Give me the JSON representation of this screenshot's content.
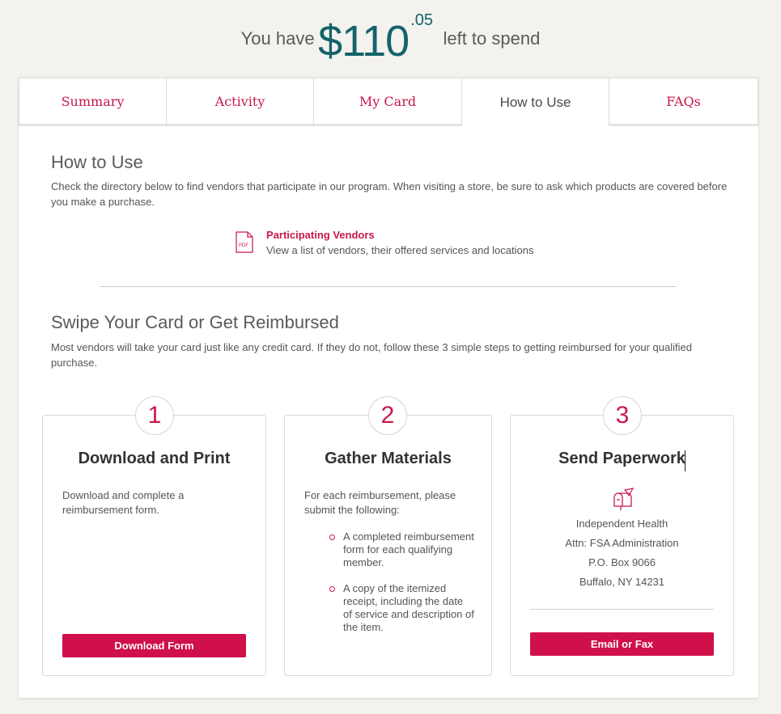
{
  "balance": {
    "prefix": "You have",
    "dollars": "$110",
    "cents": ".05",
    "suffix": "left to spend"
  },
  "tabs": [
    {
      "label": "Summary",
      "active": false
    },
    {
      "label": "Activity",
      "active": false
    },
    {
      "label": "My Card",
      "active": false
    },
    {
      "label": "How to Use",
      "active": true
    },
    {
      "label": "FAQs",
      "active": false
    }
  ],
  "how_to_use": {
    "title": "How to Use",
    "description": "Check the directory below to find vendors that participate in our program. When visiting a store, be sure to ask which products are covered before you make a purchase.",
    "pdf_icon_label": "PDF",
    "vendor_link": "Participating Vendors",
    "vendor_desc": "View a list of vendors, their offered services and locations"
  },
  "swipe": {
    "title": "Swipe Your Card or Get Reimbursed",
    "description": "Most vendors will take your card just like any credit card. If they do not, follow these 3 simple steps to getting reimbursed for your qualified purchase."
  },
  "steps": [
    {
      "number": "1",
      "title": "Download and Print",
      "text": "Download and complete a reimbursement form.",
      "button": "Download Form"
    },
    {
      "number": "2",
      "title": "Gather Materials",
      "text": "For each reimbursement, please submit the following:",
      "bullets": [
        "A completed reimbursement form for each qualifying member.",
        "A copy of the itemized receipt, including the date of service and description of the item."
      ]
    },
    {
      "number": "3",
      "title": "Send Paperwork",
      "address": [
        "Independent Health",
        "Attn: FSA Administration",
        "P.O. Box 9066",
        "Buffalo, NY 14231"
      ],
      "button": "Email or Fax"
    }
  ],
  "colors": {
    "accent": "#c8184a",
    "button": "#d0104a",
    "balance": "#14636a",
    "background": "#f3f2ef"
  }
}
